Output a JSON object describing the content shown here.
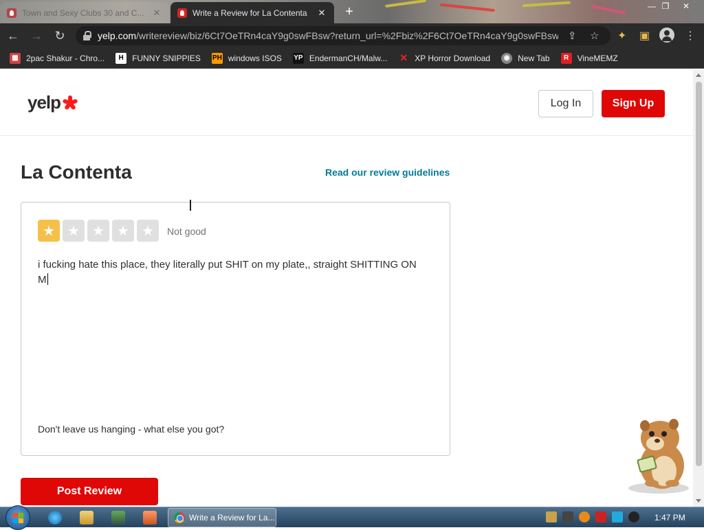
{
  "browser": {
    "tabs": [
      {
        "title": "Town and Sexy Clubs 30 and C...",
        "active": false
      },
      {
        "title": "Write a Review for La Contenta",
        "active": true
      }
    ],
    "url_domain": "yelp.com",
    "url_path": "/writereview/biz/6Ct7OeTRn4caY9g0swFBsw?return_url=%2Fbiz%2F6Ct7OeTRn4caY9g0swFBsw&...",
    "bookmarks": [
      {
        "label": "2pac Shakur - Chro...",
        "icon": "calendar-icon",
        "color": "#c44"
      },
      {
        "label": "FUNNY SNIPPIES",
        "icon": "h-letter-icon",
        "color": "#ffffff"
      },
      {
        "label": "windows ISOS",
        "icon": "ph-icon",
        "color": "#f90"
      },
      {
        "label": "EndermanCH/Malw...",
        "icon": "yp-icon",
        "color": "#222"
      },
      {
        "label": "XP Horror Download",
        "icon": "x-icon",
        "color": "#e22"
      },
      {
        "label": "New Tab",
        "icon": "globe-icon",
        "color": "#aaa"
      },
      {
        "label": "VineMEMZ",
        "icon": "r-letter-icon",
        "color": "#d22"
      }
    ]
  },
  "header": {
    "logo_text": "yelp",
    "login_label": "Log In",
    "signup_label": "Sign Up"
  },
  "main": {
    "business_name": "La Contenta",
    "guidelines_link": "Read our review guidelines",
    "rating": 1,
    "rating_max": 5,
    "rating_text": "Not good",
    "review_text": "i fucking hate this place, they literally put SHIT on my plate,, straight SHITTING ON M",
    "prompt_text": "Don't leave us hanging - what else you got?",
    "post_label": "Post Review"
  },
  "taskbar": {
    "active_window": "Write a Review for La...",
    "clock": "1:47 PM"
  },
  "colors": {
    "brand_red": "#e00707",
    "star_active": "#f5c04a",
    "link_teal": "#027a97"
  }
}
